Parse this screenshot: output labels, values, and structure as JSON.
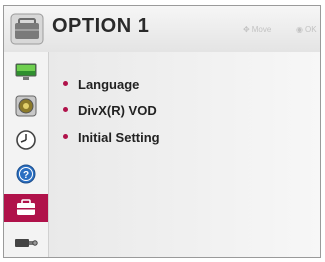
{
  "header": {
    "title": "OPTION 1",
    "hint_move": "Move",
    "hint_ok": "OK",
    "icon": "toolbox-icon"
  },
  "sidebar": {
    "items": [
      {
        "icon": "picture-icon",
        "active": false
      },
      {
        "icon": "speaker-icon",
        "active": false
      },
      {
        "icon": "clock-icon",
        "active": false
      },
      {
        "icon": "help-icon",
        "active": false
      },
      {
        "icon": "toolbox-icon",
        "active": true
      },
      {
        "icon": "input-device-icon",
        "active": false
      }
    ]
  },
  "menu": {
    "items": [
      {
        "label": "Language"
      },
      {
        "label": "DivX(R) VOD"
      },
      {
        "label": "Initial Setting"
      }
    ]
  },
  "colors": {
    "accent": "#b0124a",
    "header_bg": "#ececec",
    "panel_bg": "#f1f1f1"
  }
}
